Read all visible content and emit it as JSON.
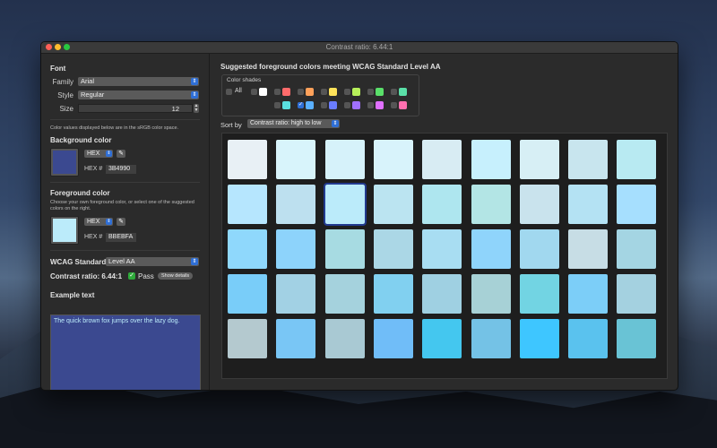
{
  "window": {
    "title": "Contrast ratio: 6.44:1"
  },
  "font": {
    "section_title": "Font",
    "family_label": "Family",
    "family_value": "Arial",
    "style_label": "Style",
    "style_value": "Regular",
    "size_label": "Size",
    "size_value": "12"
  },
  "color_note": "Color values displayed below are in the sRGB color space.",
  "background": {
    "title": "Background color",
    "mode": "HEX",
    "hex_label": "HEX #",
    "hex_value": "3B4990",
    "color": "#3b4990"
  },
  "foreground": {
    "title": "Foreground color",
    "note": "Choose your own foreground color, or select one of the suggested colors on the right.",
    "mode": "HEX",
    "hex_label": "HEX #",
    "hex_value": "BBEBFA",
    "color": "#bbebfa"
  },
  "wcag": {
    "label": "WCAG Standard",
    "value": "Level AA"
  },
  "contrast": {
    "label": "Contrast ratio: 6.44:1",
    "pass_label": "Pass",
    "details_label": "Show details"
  },
  "example": {
    "title": "Example text",
    "text": "The quick brown fox jumps over the lazy dog."
  },
  "suggestions": {
    "heading": "Suggested foreground colors meeting WCAG Standard Level AA",
    "shades_title": "Color shades",
    "all_label": "All",
    "shade_row1": [
      "#ffffff",
      "#ff6b6b",
      "#ffa15a",
      "#ffe35a",
      "#b7f05a",
      "#5ae06a",
      "#5ae0a8"
    ],
    "shade_row2": [
      "#5ae0e0",
      "#5ab0ff",
      "#6a7dff",
      "#a070ff",
      "#e070ff",
      "#ff70b0"
    ],
    "sort_label": "Sort by",
    "sort_value": "Contrast ratio: high to low"
  },
  "tiles": [
    [
      "#e8f0f5",
      "#d8f4fb",
      "#d6f2fa",
      "#d8f3fb",
      "#d8ecf3",
      "#c7f0fd",
      "#d7eff5",
      "#c8e5ee",
      "#b8eaf2"
    ],
    [
      "#b6e6fe",
      "#bde0ef",
      "#bbebfa",
      "#bbe4f1",
      "#aee6ef",
      "#b3e5e5",
      "#c9e3ed",
      "#b4e2f3",
      "#a6dffe"
    ],
    [
      "#8fd8fc",
      "#8dd3fb",
      "#a7dbe2",
      "#abd7e6",
      "#a8ddf2",
      "#8fd4fb",
      "#a1d8ef",
      "#c7dde5",
      "#a4d5e3"
    ],
    [
      "#79cdf9",
      "#a2d1e4",
      "#a5d2dd",
      "#81d0f0",
      "#9fd0e2",
      "#a7d1d6",
      "#72d4e3",
      "#7ccef8",
      "#a4d1e0"
    ],
    [
      "#b4c9cf",
      "#79c6f5",
      "#a9c9d3",
      "#70bdf8",
      "#44c7ef",
      "#74c2e6",
      "#3ec6ff",
      "#5ac2ee",
      "#69c3d5"
    ]
  ]
}
